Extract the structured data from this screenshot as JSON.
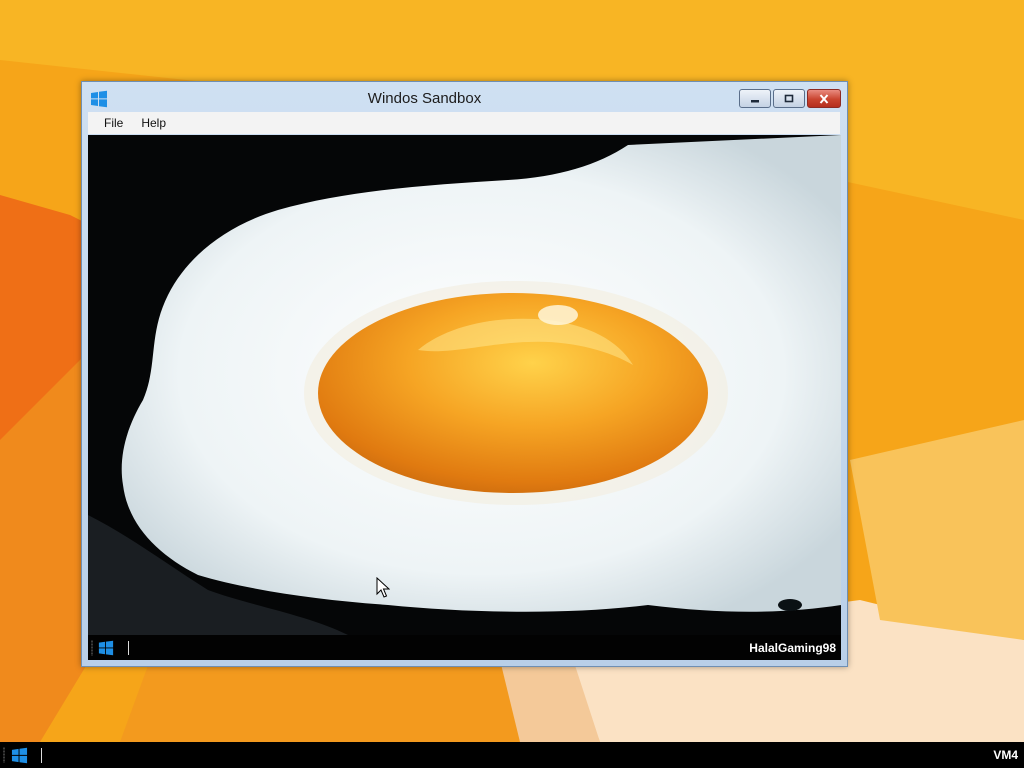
{
  "colors": {
    "wallpaper_primary": "#f7a81c",
    "wallpaper_secondary": "#f06a14",
    "taskbar": "#000000",
    "close_button": "#c9442f",
    "windows_logo": "#1e90e6"
  },
  "window": {
    "title": "Windos Sandbox",
    "logo_icon": "windows-logo-icon",
    "minimize_icon": "minimize-icon",
    "maximize_icon": "maximize-icon",
    "close_icon": "close-icon"
  },
  "menu": {
    "items": [
      {
        "label": "File"
      },
      {
        "label": "Help"
      }
    ]
  },
  "vm": {
    "content": "fried-egg-image",
    "taskbar": {
      "start_icon": "windows-logo-icon",
      "user_label": "HalalGaming98"
    }
  },
  "taskbar": {
    "start_icon": "windows-logo-icon",
    "label": "VM4"
  }
}
